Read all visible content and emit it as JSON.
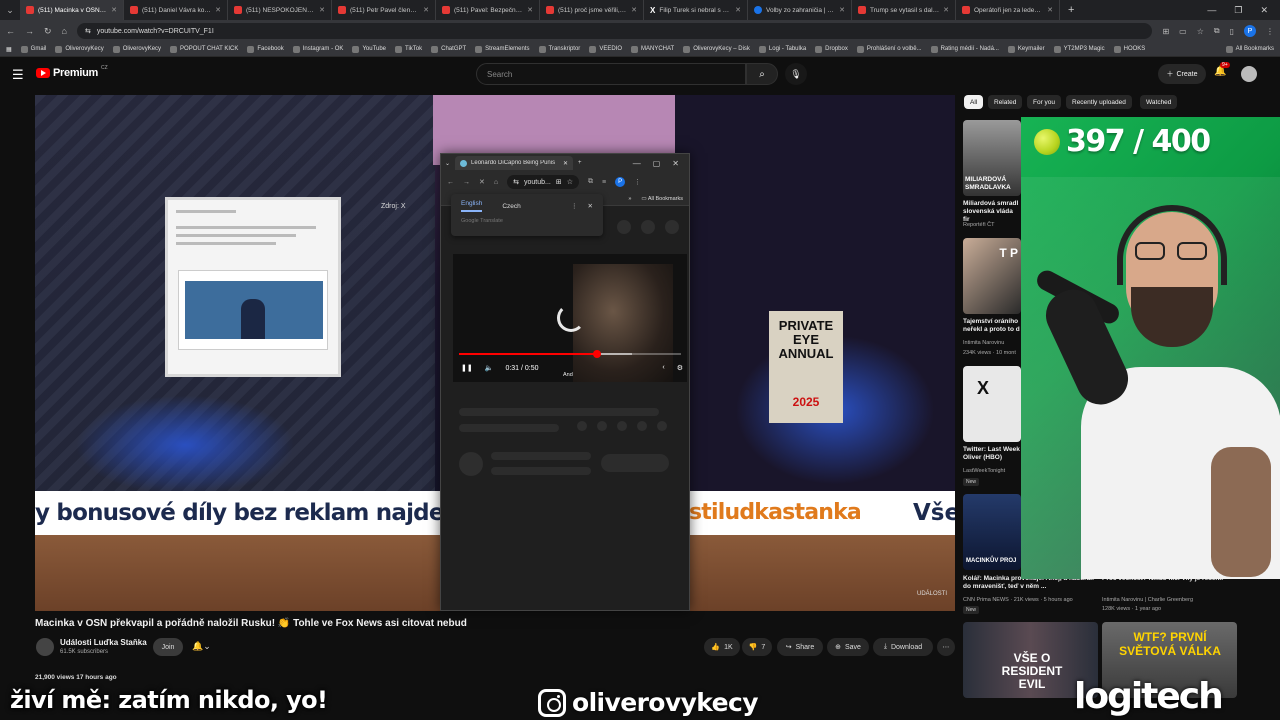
{
  "browser": {
    "tabs": [
      {
        "label": "(511) Macinka v OSN překvap",
        "active": true
      },
      {
        "label": "(511) Daniel Vávra končí s výp"
      },
      {
        "label": "(511) NESPOKOJENÝ OBČAN"
      },
      {
        "label": "(511) Petr Pavel členem kom"
      },
      {
        "label": "(511) Pavel: Bezpečnost je od"
      },
      {
        "label": "(511) proč jsme věřili, že v ro"
      },
      {
        "label": "Filip Turek si nebral s Petrem"
      },
      {
        "label": "Volby zo zahraničia | Fico po"
      },
      {
        "label": "Trump se vytasil s dalším tem"
      },
      {
        "label": "Operátoři jen za leden zablo"
      }
    ],
    "url": "youtube.com/watch?v=DRCUITV_F1I",
    "profile_initial": "P",
    "bookmarks": [
      "Gmail",
      "OliverovyKecy",
      "OliverovyKecy",
      "POPOUT CHAT KICK",
      "Facebook",
      "Instagram - OK",
      "YouTube",
      "TikTok",
      "ChatGPT",
      "StreamElements",
      "Transkriptor",
      "VEEDIO",
      "MANYCHAT",
      "OliverovyKecy – Disk",
      "Logi - Tabulka",
      "Dropbox",
      "Prohlášení o volbě...",
      "Rating médií - Nadá...",
      "Keymailer",
      "YT2MP3 Magic",
      "HOOKS"
    ],
    "all_bookmarks": "All Bookmarks"
  },
  "youtube": {
    "brand": "Premium",
    "country": "CZ",
    "search_placeholder": "Search",
    "create_label": "Create",
    "notif_count": "9+",
    "chips": [
      "All",
      "Related",
      "For you",
      "Recently uploaded",
      "Watched"
    ]
  },
  "player": {
    "zdroj": "Zdroj: X",
    "book_title": "PRIVATE EYE ANNUAL",
    "book_year": "2025",
    "ticker_left": "y bonusové díly bez reklam najdete na",
    "ticker_mid": "stiludkastanka",
    "ticker_right": "Vše",
    "watermark": "UDÁLOSTI"
  },
  "popup": {
    "tab_title": "Leonardo DiCaprio Being Punis",
    "omni_text": "youtub...",
    "all_bookmarks": "All Bookmarks",
    "translate_lang1": "English",
    "translate_lang2": "Czech",
    "translate_brand": "Google Translate",
    "time": "0:31 / 0:50",
    "subtitle": "And",
    "progress_played": 0.62,
    "progress_buffered": 0.78
  },
  "video": {
    "title": "Macinka v OSN překvapil a pořádně naložil Rusku! 👏 Tohle ve Fox News asi citovat nebud",
    "channel": "Události Luďka Staňka",
    "subscribers": "61.5K subscribers",
    "join_label": "Join",
    "likes": "1K",
    "dislikes": "7",
    "share": "Share",
    "save": "Save",
    "download": "Download",
    "views": "21,900 views  17 hours ago"
  },
  "recommendations": [
    {
      "thumb_text": "MILIARDOVÁ SMRADLAVKA",
      "title": "Miliardová smradl slovenská vláda fir",
      "meta": "Reportéři ČT"
    },
    {
      "thumb_text": "T P",
      "title": "Tajemství oráního neřekl a proto to d",
      "meta": "Intimita Narovinu",
      "meta2": "234K views · 10 mont"
    },
    {
      "thumb_text": "X",
      "title": "Twitter: Last Week Oliver (HBO)",
      "meta": "LastWeekTonight",
      "badge": "New"
    },
    {
      "thumb_text": "MACINKŮV PROJ",
      "title": "Kolář: Macinka provokuje. Ahoj, a nacůrali do mravenišť, teď v něm ...",
      "meta": "CNN Prima NEWS · 21K views · 5 hours ago",
      "badge": "New"
    },
    {
      "title": "Proč věčnost? Nikdo nic. Víly je řešení.",
      "meta": "Intimita Narovinu | Charlie Greenberg",
      "meta2": "128K views · 1 year ago"
    },
    {
      "thumb_text": "VŠE O RESIDENT EVIL",
      "title": ""
    },
    {
      "thumb_text": "WTF? PRVNÍ SVĚTOVÁ VÁLKA",
      "title": ""
    }
  ],
  "overlay": {
    "counter": "397 / 400",
    "left_text": "živí mě: zatím nikdo, yo!",
    "instagram": "oliverovykecy",
    "sponsor": "logitech"
  }
}
